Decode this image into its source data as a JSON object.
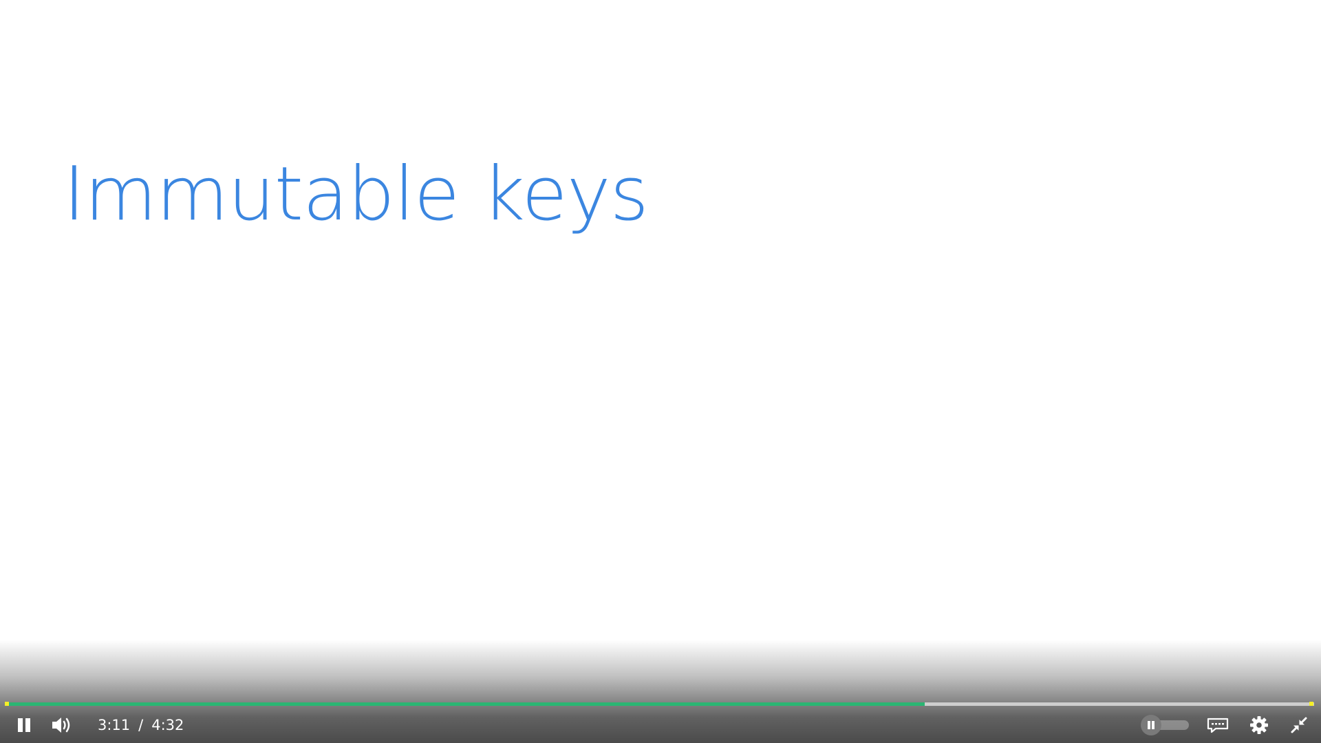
{
  "slide": {
    "title": "Immutable keys"
  },
  "player": {
    "current_time": "3:11",
    "separator": "/",
    "duration": "4:32",
    "progress_fraction": 0.702,
    "icons": {
      "play_pause": "pause-icon",
      "volume": "volume-icon",
      "autoplay": "autoplay-toggle",
      "captions": "captions-icon",
      "settings": "gear-icon",
      "fullscreen": "exit-fullscreen-icon"
    }
  },
  "colors": {
    "title": "#3b86e0",
    "progress": "#2bb673",
    "marker": "#f5ef28"
  }
}
